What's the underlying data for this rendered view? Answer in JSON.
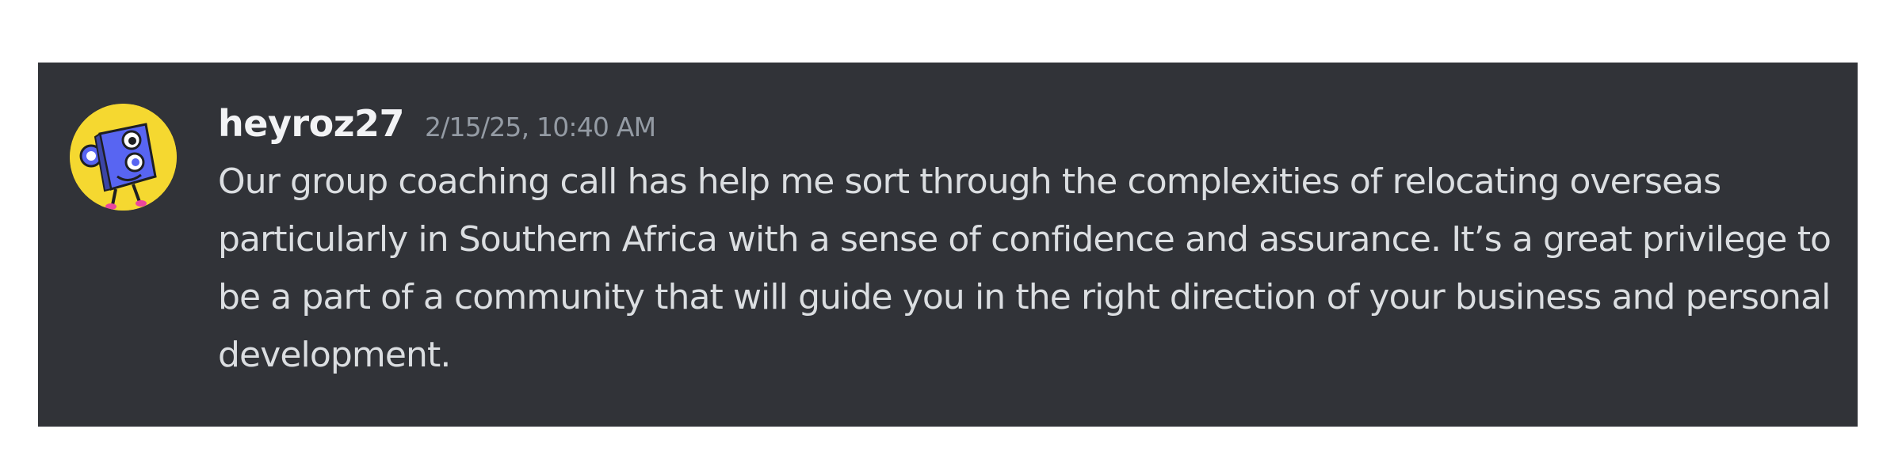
{
  "message": {
    "username": "heyroz27",
    "timestamp": "2/15/25, 10:40 AM",
    "text": "Our group coaching call has help me sort through the complexities of relocating overseas particularly in Southern Africa with a sense of confidence and assurance. It’s a great privilege to be a part of a community that will guide you in the right direction of your business and personal development."
  },
  "colors": {
    "card_background": "#313338",
    "username": "#f2f3f5",
    "timestamp": "#949ba4",
    "message_text": "#dbdee1",
    "avatar_background": "#f5d830"
  },
  "icons": {
    "avatar": "blue-robot-avatar-icon"
  }
}
